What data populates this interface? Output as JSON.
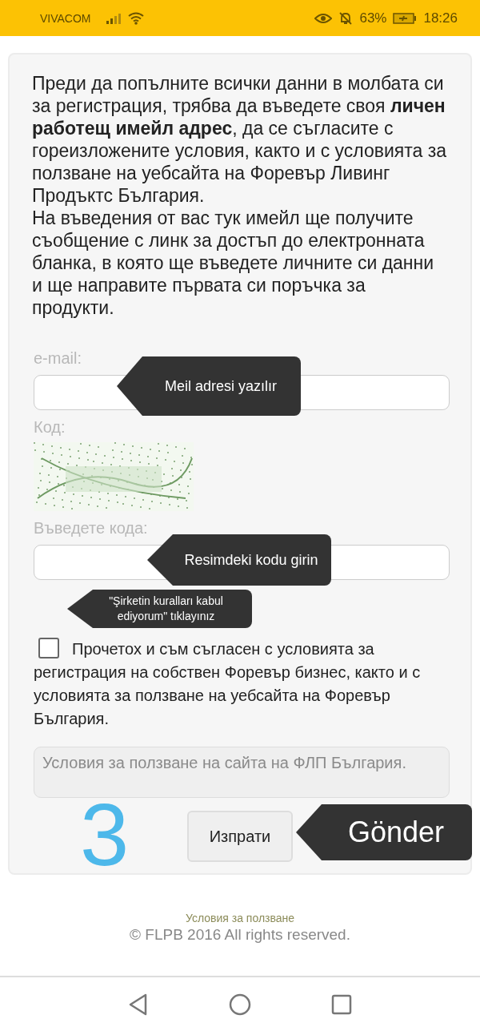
{
  "status_bar": {
    "carrier": "VIVACOM",
    "battery": "63%",
    "time": "18:26"
  },
  "intro": [
    "Преди да попълните всички данни в молбата си за регистрация, трябва да въведете своя **личен работещ имейл адрес**, да се съгласите с гореизложените условия, както и с условията за ползване на уебсайта на Форевър Ливинг Продъктс България.",
    "На въведения от вас тук имейл ще получите съобщение с линк за достъп до електронната бланка, в която ще въведете личните си данни и ще направите първата си поръчка за продукти."
  ],
  "email": {
    "label": "e-mail:"
  },
  "captcha": {
    "label": "Код:",
    "kind": "picture"
  },
  "code": {
    "label": "Въведете кода:"
  },
  "agree": {
    "checked": false,
    "text": [
      "Прочетох и съм съгласен с условията за",
      "регистрация на собствен Форевър бизнес, както и с условията за ползване на уебсайта на Форевър България."
    ]
  },
  "terms_box": {
    "text": "Условия за ползване на сайта на ФЛП България."
  },
  "submit": {
    "label": "Изпрати"
  },
  "footer": {
    "link": "Условия за ползване",
    "copyright": "© FLPB 2016 All rights reserved."
  },
  "annotations": [
    {
      "kind": "tooltip",
      "text": "Meil adresi yazılır"
    },
    {
      "kind": "tooltip",
      "text": "Resimdeki kodu girin"
    },
    {
      "kind": "hint",
      "text": "\"Şirketin kuralları kabul ediyorum\" tıklayınız"
    },
    {
      "kind": "callout",
      "text": "Gönder"
    },
    {
      "kind": "step",
      "text": "3"
    }
  ]
}
